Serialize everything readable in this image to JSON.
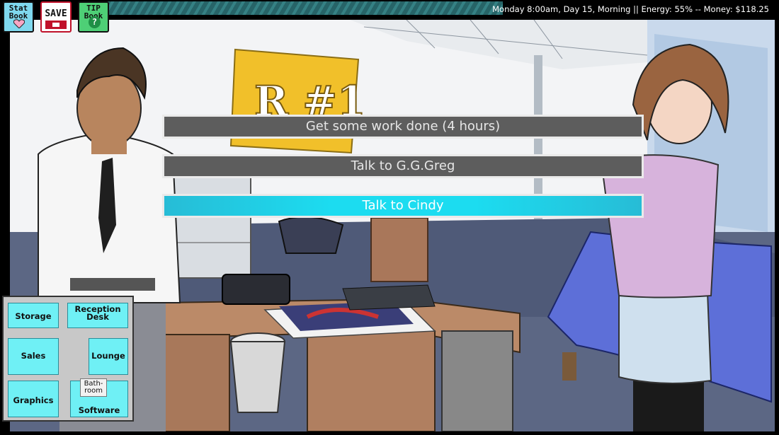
{
  "toolbar": {
    "stat_book_label": "Stat\nBook",
    "save_label": "SAVE",
    "tip_book_label": "TIP\nBook",
    "tip_book_icon_text": "?"
  },
  "status_bar": {
    "text": "Monday 8:00am, Day 15, Morning   ||   Energy: 55% -- Money: $118.25"
  },
  "choices": [
    {
      "label": "Get some work done (4 hours)",
      "selected": false
    },
    {
      "label": "Talk to G.G.Greg",
      "selected": false
    },
    {
      "label": "Talk to Cindy",
      "selected": true
    }
  ],
  "map": {
    "rooms": [
      {
        "label": "Storage"
      },
      {
        "label": "Reception Desk"
      },
      {
        "label": "Sales"
      },
      {
        "label": "Lounge"
      },
      {
        "label": "Graphics"
      },
      {
        "label": "Bath-room"
      },
      {
        "label": "Software"
      }
    ]
  },
  "scene": {
    "sign_text": "R #1"
  },
  "colors": {
    "choice_bg": "#5d5d5d",
    "choice_active": "#1cdcf0",
    "map_room": "#6ff0f5",
    "stat_book": "#7fd8ee",
    "save_red": "#c0112a",
    "tip_green": "#4ecf76"
  }
}
